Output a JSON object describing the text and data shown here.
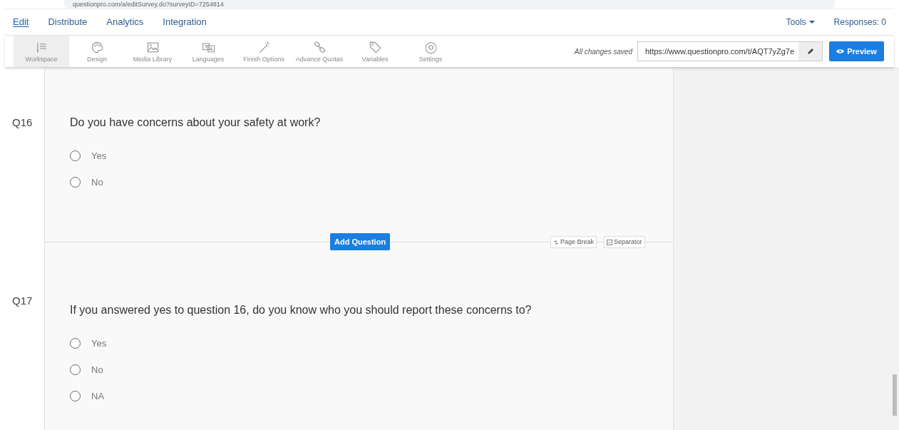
{
  "browser": {
    "url": "questionpro.com/a/editSurvey.do?surveyID=7254814"
  },
  "nav": {
    "tabs": [
      {
        "label": "Edit",
        "selected": true
      },
      {
        "label": "Distribute",
        "selected": false
      },
      {
        "label": "Analytics",
        "selected": false
      },
      {
        "label": "Integration",
        "selected": false
      }
    ],
    "tools": "Tools",
    "responses": "Responses: 0"
  },
  "toolbar": {
    "items": [
      {
        "kind": "workspace",
        "label": "Workspace",
        "selected": true
      },
      {
        "kind": "design",
        "label": "Design",
        "selected": false
      },
      {
        "kind": "media",
        "label": "Media Library",
        "selected": false
      },
      {
        "kind": "languages",
        "label": "Languages",
        "selected": false
      },
      {
        "kind": "finish",
        "label": "Finish Options",
        "selected": false
      },
      {
        "kind": "quotas",
        "label": "Advance Quotas",
        "selected": false
      },
      {
        "kind": "variables",
        "label": "Variables",
        "selected": false
      },
      {
        "kind": "settings",
        "label": "Settings",
        "selected": false
      }
    ],
    "save_status": "All changes saved",
    "share_url": "https://www.questionpro.com/t/AQT7yZg7e",
    "preview": "Preview"
  },
  "questions": [
    {
      "number": "Q16",
      "text": "Do you have concerns about your safety at work?",
      "options": [
        {
          "label": "Yes",
          "selected": false
        },
        {
          "label": "No",
          "selected": false
        }
      ]
    },
    {
      "number": "Q17",
      "text": "If you answered yes to question 16, do you know who you should report these concerns to?",
      "options": [
        {
          "label": "Yes",
          "selected": false
        },
        {
          "label": "No",
          "selected": false
        },
        {
          "label": "NA",
          "selected": false
        }
      ]
    }
  ],
  "divider": {
    "add_question": "Add Question",
    "page_break": "Page Break",
    "separator": "Separator"
  }
}
